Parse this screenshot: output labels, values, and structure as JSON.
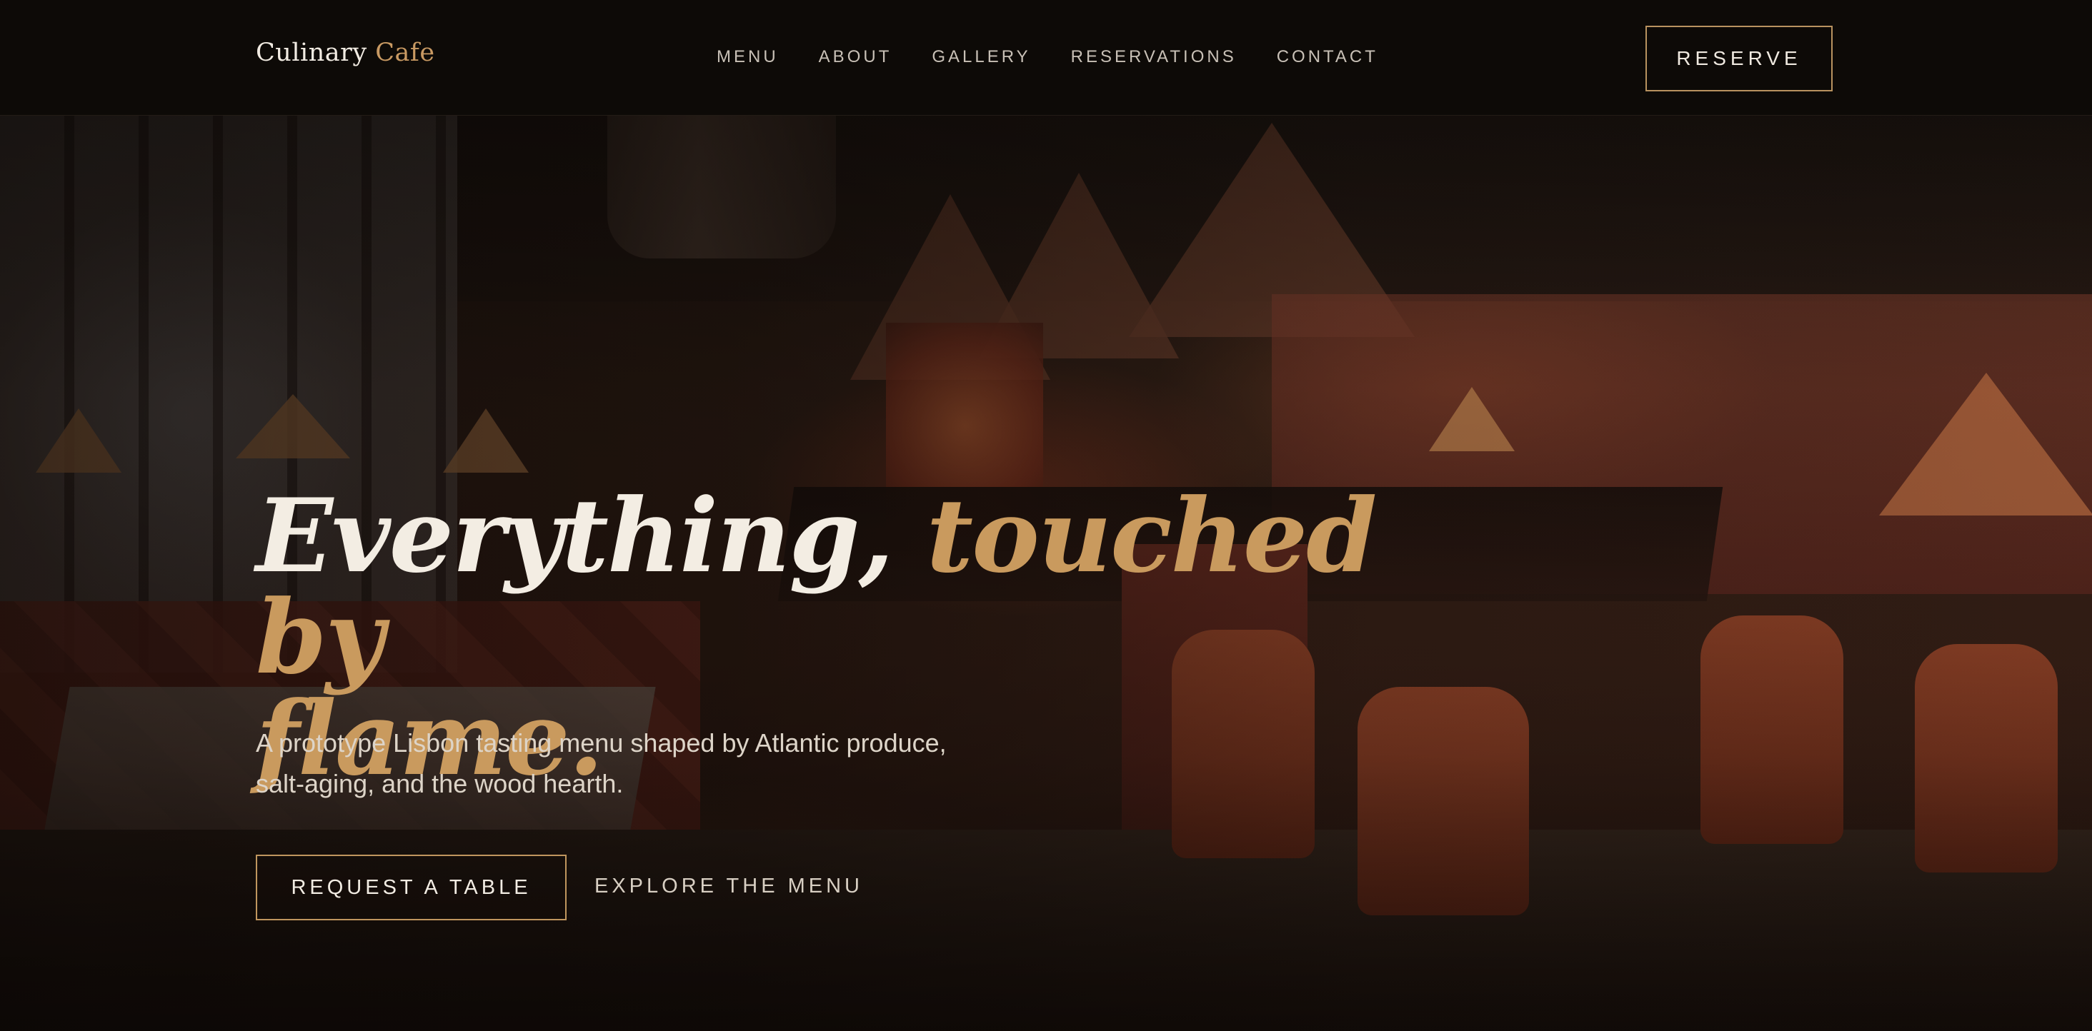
{
  "brand": {
    "name": "Culinary",
    "accent_name": "Cafe"
  },
  "nav": {
    "links": [
      "MENU",
      "ABOUT",
      "GALLERY",
      "RESERVATIONS",
      "CONTACT"
    ],
    "reserve_label": "RESERVE"
  },
  "hero": {
    "headline_plain": "Everything, ",
    "headline_accent_line1": "touched by",
    "headline_accent_line2": "flame.",
    "subtitle": "A prototype Lisbon tasting menu shaped by Atlantic produce, salt-aging, and the wood hearth.",
    "primary_cta": "REQUEST A TABLE",
    "secondary_cta": "EXPLORE THE MENU",
    "background_image": "restaurant-interior-photo"
  },
  "colors": {
    "accent_gold": "#c99a5e",
    "nav_background": "#0d0a07",
    "text_light": "#f3ede3"
  }
}
